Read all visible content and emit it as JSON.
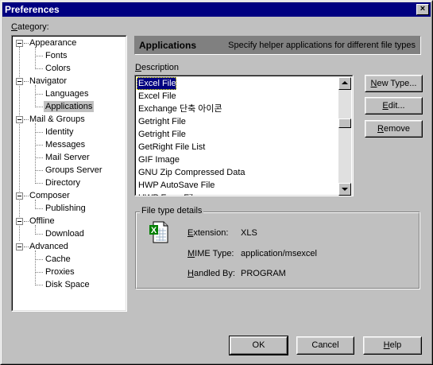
{
  "window": {
    "title": "Preferences",
    "close_glyph": "×"
  },
  "category": {
    "label": "Category:",
    "tree": [
      {
        "label": "Appearance",
        "children": [
          "Fonts",
          "Colors"
        ]
      },
      {
        "label": "Navigator",
        "children": [
          "Languages",
          "Applications"
        ]
      },
      {
        "label": "Mail & Groups",
        "children": [
          "Identity",
          "Messages",
          "Mail Server",
          "Groups Server",
          "Directory"
        ]
      },
      {
        "label": "Composer",
        "children": [
          "Publishing"
        ]
      },
      {
        "label": "Offline",
        "children": [
          "Download"
        ]
      },
      {
        "label": "Advanced",
        "children": [
          "Cache",
          "Proxies",
          "Disk Space"
        ]
      }
    ],
    "selected": "Applications"
  },
  "header": {
    "title": "Applications",
    "subtitle": "Specify helper applications for different file types"
  },
  "description": {
    "label": "Description",
    "items": [
      "Excel File",
      "Excel File",
      "Exchange 단축 아이콘",
      "Getright File",
      "Getright File",
      "GetRight File List",
      "GIF Image",
      "GNU Zip Compressed Data",
      "HWP AutoSave File",
      "HWP Form File"
    ],
    "selected_index": 0
  },
  "side_buttons": {
    "new_type": "New Type...",
    "edit": "Edit...",
    "remove": "Remove"
  },
  "details": {
    "title": "File type details",
    "icon": "excel-file-icon",
    "extension_label": "Extension:",
    "extension_value": "XLS",
    "mime_label": "MIME Type:",
    "mime_value": "application/msexcel",
    "handled_label": "Handled By:",
    "handled_value": "PROGRAM"
  },
  "footer": {
    "ok": "OK",
    "cancel": "Cancel",
    "help": "Help"
  },
  "colors": {
    "face": "#c0c0c0",
    "title_bar": "#000080",
    "selection": "#000080",
    "header_band": "#808080"
  }
}
